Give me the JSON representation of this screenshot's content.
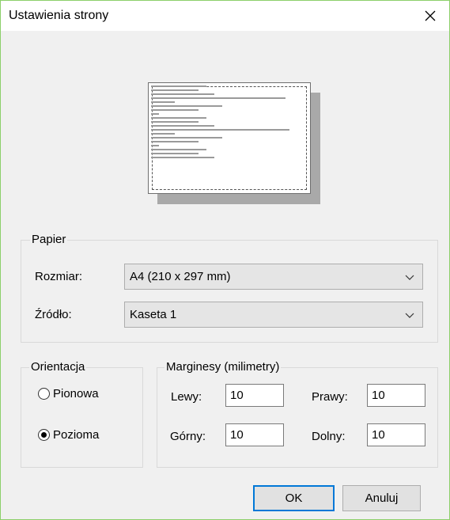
{
  "window": {
    "title": "Ustawienia strony",
    "accent": "#8ccf6a"
  },
  "icons": {
    "close": "close-icon",
    "dropdown": "chevron-down-icon"
  },
  "paper": {
    "legend": "Papier",
    "size_label": "Rozmiar:",
    "size_value": "A4 (210 x 297 mm)",
    "source_label": "Źródło:",
    "source_value": "Kaseta 1"
  },
  "orientation": {
    "legend": "Orientacja",
    "options": [
      {
        "label": "Pionowa",
        "checked": false
      },
      {
        "label": "Pozioma",
        "checked": true
      }
    ]
  },
  "margins": {
    "legend": "Marginesy (milimetry)",
    "left_label": "Lewy:",
    "left_value": "10",
    "right_label": "Prawy:",
    "right_value": "10",
    "top_label": "Górny:",
    "top_value": "10",
    "bottom_label": "Dolny:",
    "bottom_value": "10"
  },
  "buttons": {
    "ok": "OK",
    "cancel": "Anuluj"
  }
}
